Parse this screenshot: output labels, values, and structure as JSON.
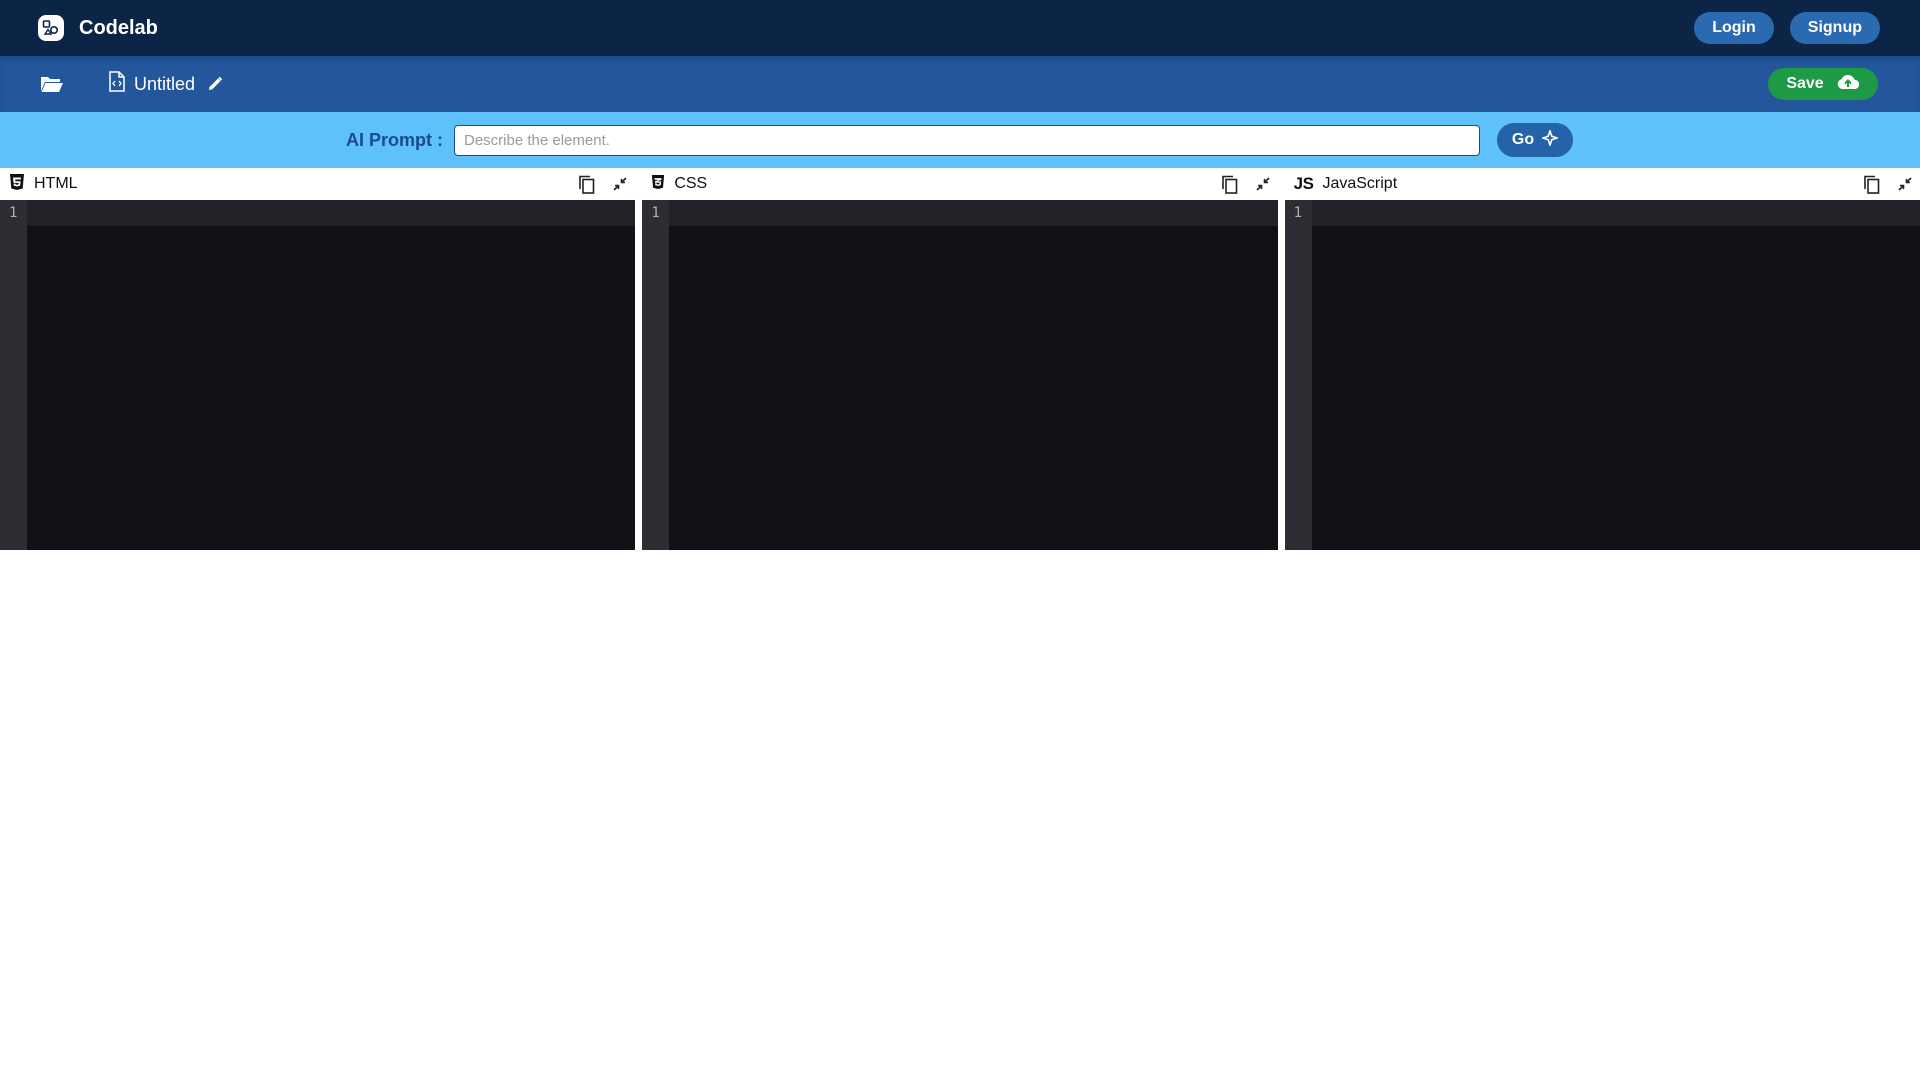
{
  "app": {
    "name": "Codelab"
  },
  "auth": {
    "login_label": "Login",
    "signup_label": "Signup"
  },
  "file": {
    "name": "Untitled",
    "save_label": "Save"
  },
  "prompt": {
    "label": "AI Prompt :",
    "placeholder": "Describe the element.",
    "value": "",
    "go_label": "Go"
  },
  "editors": [
    {
      "lang": "HTML",
      "icon": "html5-icon",
      "line_numbers": [
        "1"
      ]
    },
    {
      "lang": "CSS",
      "icon": "css3-icon",
      "line_numbers": [
        "1"
      ]
    },
    {
      "lang": "JavaScript",
      "icon_text": "JS",
      "icon": "js-icon",
      "line_numbers": [
        "1"
      ]
    }
  ],
  "colors": {
    "topbar": "#0c2547",
    "filebar": "#23569b",
    "promptbar": "#5ec1fb",
    "button_blue": "#2a6ab0",
    "save_green": "#1c9a45",
    "editor_bg": "#0f1117",
    "gutter_bg": "#2d2e33"
  }
}
